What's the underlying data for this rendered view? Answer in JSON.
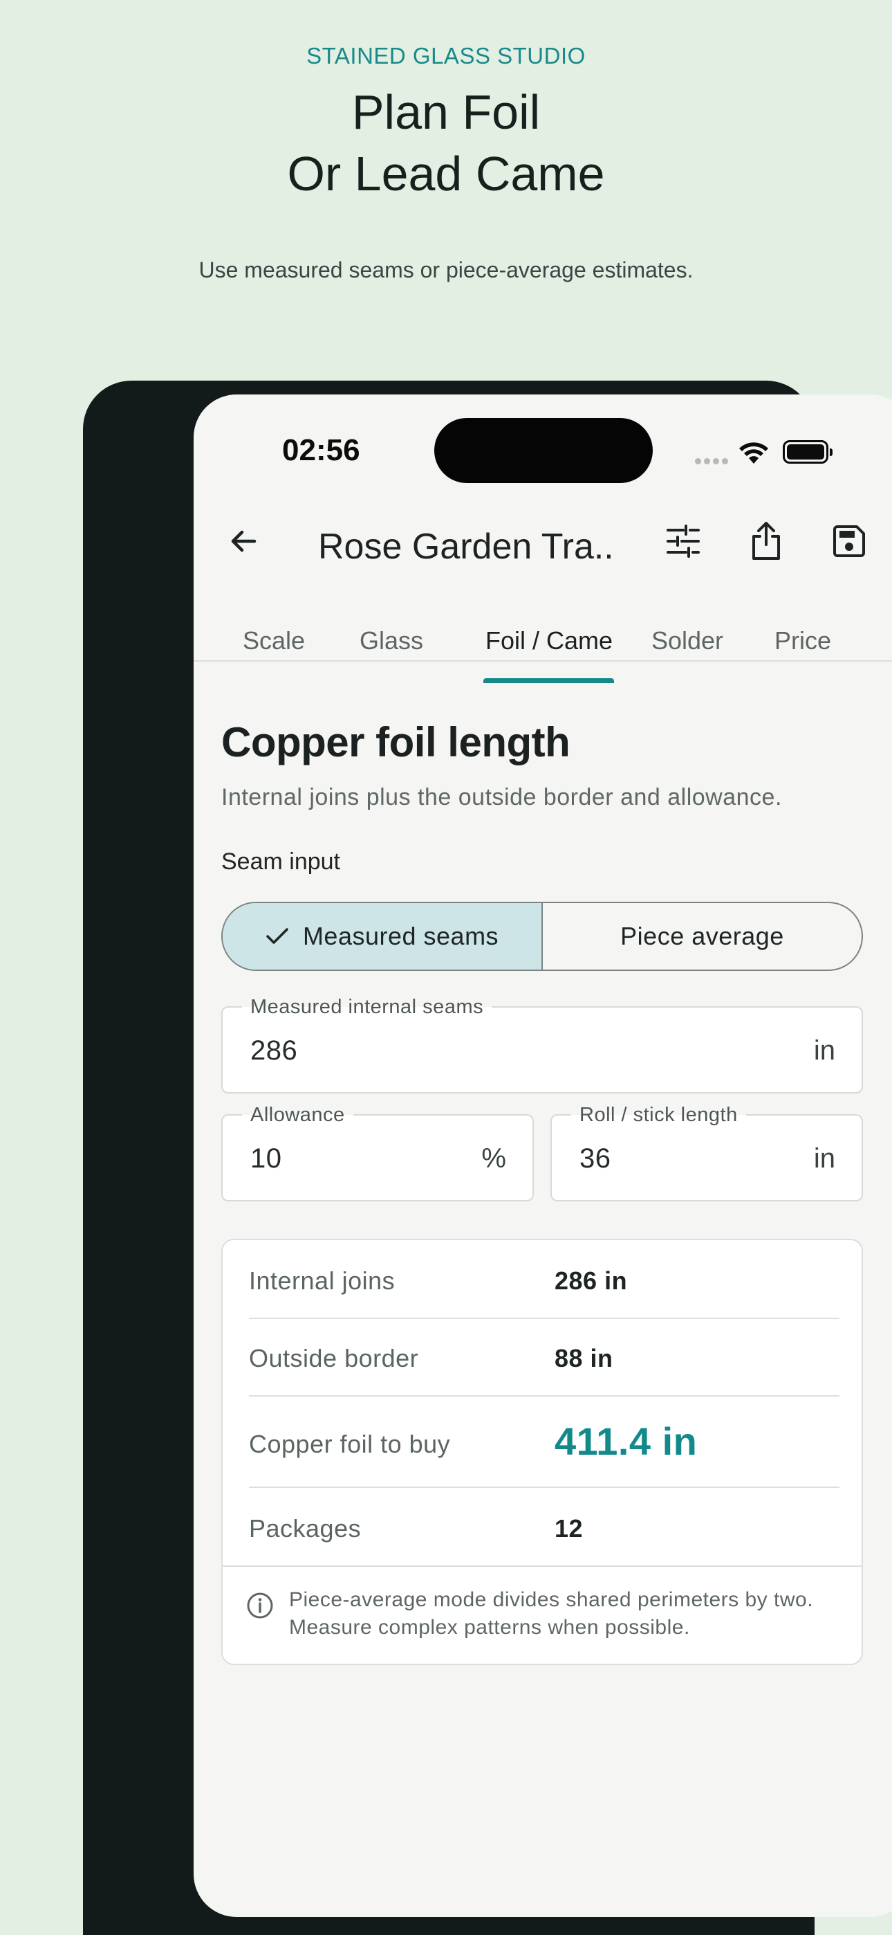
{
  "marketing": {
    "eyebrow": "STAINED GLASS STUDIO",
    "headline_line1": "Plan Foil",
    "headline_line2": "Or Lead Came",
    "subline": "Use measured seams or piece-average estimates."
  },
  "status_bar": {
    "time": "02:56"
  },
  "app_bar": {
    "title": "Rose Garden Tra...",
    "icons": [
      "back-arrow-icon",
      "tune-sliders-icon",
      "share-icon",
      "save-icon"
    ]
  },
  "tabs": [
    {
      "label": "Scale",
      "active": false
    },
    {
      "label": "Glass",
      "active": false
    },
    {
      "label": "Foil / Came",
      "active": true
    },
    {
      "label": "Solder",
      "active": false
    },
    {
      "label": "Price",
      "active": false
    }
  ],
  "section": {
    "title": "Copper foil length",
    "description": "Internal joins plus the outside border and allowance."
  },
  "seam_input": {
    "label": "Seam input",
    "options": [
      "Measured seams",
      "Piece average"
    ],
    "selected": "Measured seams"
  },
  "fields": {
    "measured": {
      "label": "Measured internal seams",
      "value": "286",
      "unit": "in"
    },
    "allowance": {
      "label": "Allowance",
      "value": "10",
      "unit": "%"
    },
    "roll": {
      "label": "Roll / stick length",
      "value": "36",
      "unit": "in"
    }
  },
  "results": [
    {
      "label": "Internal joins",
      "value": "286 in"
    },
    {
      "label": "Outside border",
      "value": "88 in"
    },
    {
      "label": "Copper foil to buy",
      "value": "411.4 in"
    },
    {
      "label": "Packages",
      "value": "12"
    }
  ],
  "note": "Piece-average mode divides shared perimeters by two. Measure complex patterns when possible.",
  "colors": {
    "accent": "#13898a",
    "background": "#e3efe3",
    "device": "#121b1a",
    "selected_segment": "#cde5e7"
  }
}
